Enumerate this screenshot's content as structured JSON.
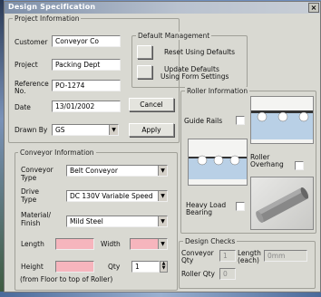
{
  "title": "Design Specification",
  "project": {
    "group_label": "Project Information",
    "customer_label": "Customer",
    "customer_value": "Conveyor Co",
    "project_label": "Project",
    "project_value": "Packing Dept",
    "reference_label_1": "Reference",
    "reference_label_2": "No.",
    "reference_value": "PO-1274",
    "date_label": "Date",
    "date_value": "13/01/2002",
    "drawn_by_label": "Drawn By",
    "drawn_by_value": "GS",
    "cancel_label": "Cancel",
    "apply_label": "Apply"
  },
  "default_mgmt": {
    "group_label": "Default Management",
    "reset_label": "Reset Using Defaults",
    "update_label_1": "Update Defaults",
    "update_label_2": "Using Form Settings"
  },
  "roller": {
    "group_label": "Roller Information",
    "guide_rails_label": "Guide Rails",
    "overhang_label_1": "Roller",
    "overhang_label_2": "Overhang",
    "heavy_label_1": "Heavy Load",
    "heavy_label_2": "Bearing"
  },
  "conveyor": {
    "group_label": "Conveyor Information",
    "type_label_1": "Conveyor",
    "type_label_2": "Type",
    "type_value": "Belt Conveyor",
    "drive_label_1": "Drive",
    "drive_label_2": "Type",
    "drive_value": "DC 130V Variable Speed",
    "material_label_1": "Material/",
    "material_label_2": "Finish",
    "material_value": "Mild Steel",
    "length_label": "Length",
    "width_label": "Width",
    "height_label": "Height",
    "qty_label": "Qty",
    "qty_value": "1",
    "height_note": "(from Floor to top of Roller)"
  },
  "checks": {
    "group_label": "Design Checks",
    "conveyor_qty_label_1": "Conveyor",
    "conveyor_qty_label_2": "Qty",
    "conveyor_qty_value": "1",
    "length_each_label_1": "Length",
    "length_each_label_2": "(each)",
    "length_each_value": "0mm",
    "roller_qty_label": "Roller Qty",
    "roller_qty_value": "0"
  }
}
